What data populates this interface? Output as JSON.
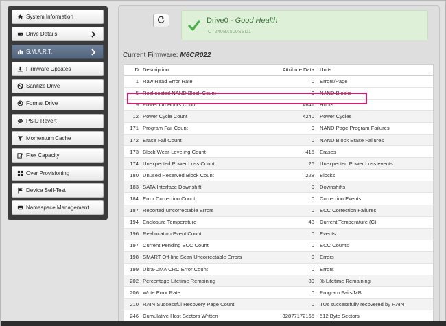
{
  "sidebar": {
    "items": [
      {
        "label": "System Information",
        "icon": "house-icon",
        "active": false,
        "chevron": false
      },
      {
        "label": "Drive Details",
        "icon": "drive-icon",
        "active": false,
        "chevron": true
      },
      {
        "label": "S.M.A.R.T.",
        "icon": "bar-chart-icon",
        "active": true,
        "chevron": true
      },
      {
        "label": "Firmware Updates",
        "icon": "download-icon",
        "active": false,
        "chevron": false
      },
      {
        "label": "Sanitize Drive",
        "icon": "ban-icon",
        "active": false,
        "chevron": false
      },
      {
        "label": "Format Drive",
        "icon": "record-icon",
        "active": false,
        "chevron": false
      },
      {
        "label": "PSID Revert",
        "icon": "eye-slash-icon",
        "active": false,
        "chevron": false
      },
      {
        "label": "Momentum Cache",
        "icon": "filter-icon",
        "active": false,
        "chevron": false
      },
      {
        "label": "Flex Capacity",
        "icon": "edit-icon",
        "active": false,
        "chevron": false
      },
      {
        "label": "Over Provisioning",
        "icon": "grid-icon",
        "active": false,
        "chevron": false
      },
      {
        "label": "Device Self-Test",
        "icon": "flag-icon",
        "active": false,
        "chevron": false
      },
      {
        "label": "Namespace Management",
        "icon": "hdd-icon",
        "active": false,
        "chevron": false
      }
    ]
  },
  "health": {
    "drive": "Drive0",
    "separator": " - ",
    "state": "Good Health",
    "model": "CT240BX500SSD1",
    "color": "#3c763d"
  },
  "firmware": {
    "label": "Current Firmware: ",
    "value": "M6CR022"
  },
  "smart_table": {
    "headers": {
      "id": "ID",
      "description": "Description",
      "attribute": "Attribute Data",
      "units": "Units"
    },
    "rows": [
      {
        "id": "1",
        "description": "Raw Read Error Rate",
        "attribute": "0",
        "units": "Errors/Page"
      },
      {
        "id": "5",
        "description": "Reallocated NAND Block Count",
        "attribute": "0",
        "units": "NAND Blocks"
      },
      {
        "id": "9",
        "description": "Power On Hours Count",
        "attribute": "4641",
        "units": "Hours"
      },
      {
        "id": "12",
        "description": "Power Cycle Count",
        "attribute": "4240",
        "units": "Power Cycles"
      },
      {
        "id": "171",
        "description": "Program Fail Count",
        "attribute": "0",
        "units": "NAND Page Program Failures"
      },
      {
        "id": "172",
        "description": "Erase Fail Count",
        "attribute": "0",
        "units": "NAND Block Erase Failures"
      },
      {
        "id": "173",
        "description": "Block Wear-Leveling Count",
        "attribute": "415",
        "units": "Erases"
      },
      {
        "id": "174",
        "description": "Unexpected Power Loss Count",
        "attribute": "26",
        "units": "Unexpected Power Loss events"
      },
      {
        "id": "180",
        "description": "Unused Reserved Block Count",
        "attribute": "228",
        "units": "Blocks"
      },
      {
        "id": "183",
        "description": "SATA Interface Downshift",
        "attribute": "0",
        "units": "Downshifts"
      },
      {
        "id": "184",
        "description": "Error Correction Count",
        "attribute": "0",
        "units": "Correction Events"
      },
      {
        "id": "187",
        "description": "Reported Uncorrectable Errors",
        "attribute": "0",
        "units": "ECC Correction Failures"
      },
      {
        "id": "194",
        "description": "Enclosure Temperature",
        "attribute": "43",
        "units": "Current Temperature (C)"
      },
      {
        "id": "196",
        "description": "Reallocation Event Count",
        "attribute": "0",
        "units": "Events"
      },
      {
        "id": "197",
        "description": "Current Pending ECC Count",
        "attribute": "0",
        "units": "ECC Counts"
      },
      {
        "id": "198",
        "description": "SMART Off-line Scan Uncorrectable Errors",
        "attribute": "0",
        "units": "Errors"
      },
      {
        "id": "199",
        "description": "Ultra-DMA CRC Error Count",
        "attribute": "0",
        "units": "Errors"
      },
      {
        "id": "202",
        "description": "Percentage Lifetime Remaining",
        "attribute": "80",
        "units": "% Lifetime Remaining"
      },
      {
        "id": "206",
        "description": "Write Error Rate",
        "attribute": "0",
        "units": "Program Fails/MB"
      },
      {
        "id": "210",
        "description": "RAIN Successful Recovery Page Count",
        "attribute": "0",
        "units": "TUs successfully recovered by RAIN"
      },
      {
        "id": "246",
        "description": "Cumulative Host Sectors Written",
        "attribute": "32877172165",
        "units": "512 Byte Sectors"
      }
    ],
    "highlight_color": "#d21d73"
  }
}
